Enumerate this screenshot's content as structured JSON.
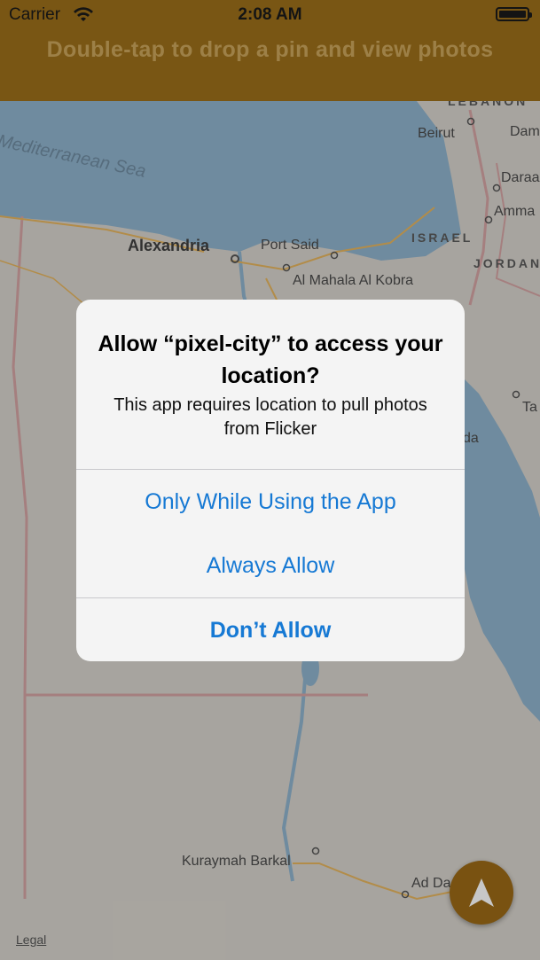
{
  "status_bar": {
    "carrier": "Carrier",
    "time": "2:08 AM"
  },
  "header": {
    "title": "Double-tap to drop a pin and view photos"
  },
  "map": {
    "labels": {
      "sea": "Mediterranean Sea",
      "alexandria": "Alexandria",
      "port_said": "Port Said",
      "al_mahala": "Al Mahala Al Kobra",
      "beirut": "Beirut",
      "damascus_partial": "Dam",
      "daraa_partial": "Daraa",
      "amman_partial": "Amma",
      "israel": "ISRAEL",
      "jordan_partial": "JORDAN",
      "lebanon_partial": "LEBANON",
      "ta_partial": "Ta",
      "da_partial": "da",
      "kuraymah": "Kuraymah Barkal",
      "ad_partial": "Ad Da"
    },
    "legal": "Legal",
    "colors": {
      "land": "#d7d3cc",
      "water": "#8fb3cc",
      "border": "#d4a3a3",
      "road": "#e5b45e"
    }
  },
  "locate_button": {
    "icon": "navigation-arrow-icon",
    "color": "#9c6a17"
  },
  "alert": {
    "title": "Allow “pixel-city” to access your location?",
    "message": "This app requires location to pull photos from Flicker",
    "buttons": {
      "while_using": "Only While Using the App",
      "always": "Always Allow",
      "dont_allow": "Don’t Allow"
    },
    "accent": "#1679d4"
  }
}
